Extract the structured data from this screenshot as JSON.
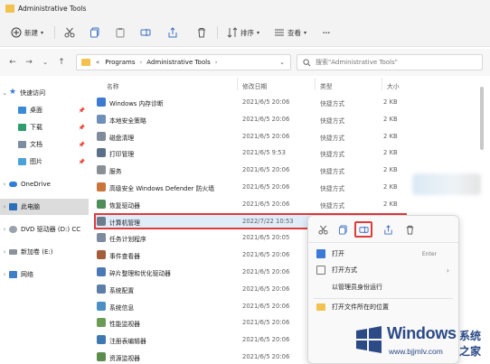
{
  "window": {
    "title": "Administrative Tools"
  },
  "toolbar": {
    "new_label": "新建",
    "sort_label": "排序",
    "view_label": "查看",
    "more_label": "···"
  },
  "address": {
    "prefix": "«",
    "segments": [
      "Programs",
      "Administrative Tools"
    ],
    "search_placeholder": "搜索\"Administrative Tools\""
  },
  "sidebar": {
    "items": [
      {
        "label": "快速访问",
        "icon": "star-icon"
      },
      {
        "label": "桌面",
        "icon": "desktop-icon"
      },
      {
        "label": "下载",
        "icon": "download-icon"
      },
      {
        "label": "文档",
        "icon": "document-icon"
      },
      {
        "label": "图片",
        "icon": "picture-icon"
      },
      {
        "label": "OneDrive",
        "icon": "cloud-icon"
      },
      {
        "label": "此电脑",
        "icon": "computer-icon"
      },
      {
        "label": "DVD 驱动器 (D:) CC",
        "icon": "dvd-icon"
      },
      {
        "label": "新加卷 (E:)",
        "icon": "drive-icon"
      },
      {
        "label": "网络",
        "icon": "network-icon"
      }
    ]
  },
  "columns": {
    "name": "名称",
    "date": "修改日期",
    "type": "类型",
    "size": "大小"
  },
  "files": [
    {
      "name": "Windows 内存诊断",
      "date": "2021/6/5 20:06",
      "type": "快捷方式",
      "size": "2 KB",
      "color": "#3d7bd1"
    },
    {
      "name": "本地安全策略",
      "date": "2021/6/5 20:06",
      "type": "快捷方式",
      "size": "2 KB",
      "color": "#6d8fb8"
    },
    {
      "name": "磁盘清理",
      "date": "2021/6/5 20:06",
      "type": "快捷方式",
      "size": "2 KB",
      "color": "#7f8c99"
    },
    {
      "name": "打印管理",
      "date": "2021/6/5 9:53",
      "type": "快捷方式",
      "size": "2 KB",
      "color": "#5b6f86"
    },
    {
      "name": "服务",
      "date": "2021/6/5 20:06",
      "type": "快捷方式",
      "size": "2 KB",
      "color": "#8a8f96"
    },
    {
      "name": "高级安全 Windows Defender 防火墙",
      "date": "2021/6/5 20:06",
      "type": "快捷方式",
      "size": "2 KB",
      "color": "#c9743a"
    },
    {
      "name": "恢复驱动器",
      "date": "2021/6/5 20:06",
      "type": "快捷方式",
      "size": "2 KB",
      "color": "#4e8e5a"
    },
    {
      "name": "计算机管理",
      "date": "2022/7/22 10:53",
      "type": "",
      "size": "",
      "color": "#6c7c8f"
    },
    {
      "name": "任务计划程序",
      "date": "2021/6/5 20:05",
      "type": "",
      "size": "",
      "color": "#7d8aa0"
    },
    {
      "name": "事件查看器",
      "date": "2021/6/5 20:06",
      "type": "",
      "size": "",
      "color": "#a35d3a"
    },
    {
      "name": "碎片整理和优化驱动器",
      "date": "2021/6/5 20:06",
      "type": "",
      "size": "",
      "color": "#4b79b5"
    },
    {
      "name": "系统配置",
      "date": "2021/6/5 20:06",
      "type": "",
      "size": "",
      "color": "#5c7fa8"
    },
    {
      "name": "系统信息",
      "date": "2021/6/5 20:06",
      "type": "",
      "size": "",
      "color": "#4c8fc2"
    },
    {
      "name": "性能监视器",
      "date": "2021/6/5 20:06",
      "type": "",
      "size": "",
      "color": "#6b9b55"
    },
    {
      "name": "注册表编辑器",
      "date": "2021/6/5 20:06",
      "type": "",
      "size": "",
      "color": "#3f78b0"
    },
    {
      "name": "资源监视器",
      "date": "2021/6/5 20:06",
      "type": "",
      "size": "",
      "color": "#5d8d4c"
    }
  ],
  "context_menu": {
    "items": [
      {
        "label": "打开",
        "shortcut": "Enter"
      },
      {
        "label": "打开方式"
      },
      {
        "label": "以管理员身份运行"
      },
      {
        "label": "打开文件所在的位置"
      }
    ]
  },
  "watermark": {
    "title": "Windows",
    "subtitle": "系统之家",
    "url": "www.bjjmlv.com"
  },
  "colors": {
    "highlight_border": "#e03b3b",
    "selection_bg": "#e1ecf9",
    "watermark": "#2b4a86",
    "folder": "#f2c14e"
  }
}
